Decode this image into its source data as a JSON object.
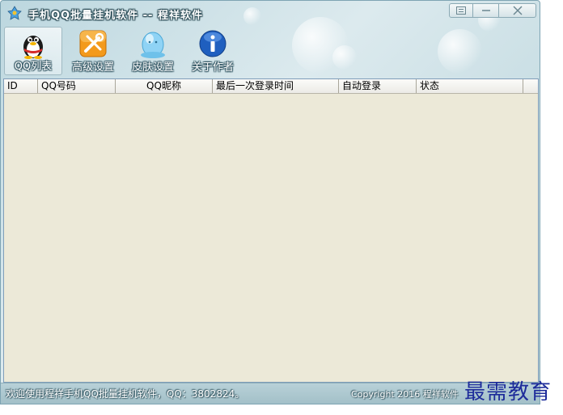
{
  "window": {
    "title": "手机QQ批量挂机软件 -- 程祥软件",
    "controls": [
      "menu-icon",
      "minimize-icon",
      "close-icon"
    ]
  },
  "toolbar": {
    "items": [
      {
        "label": "QQ列表",
        "icon": "qq-penguin-icon",
        "active": true
      },
      {
        "label": "高级设置",
        "icon": "tools-icon",
        "active": false
      },
      {
        "label": "皮肤设置",
        "icon": "skin-icon",
        "active": false
      },
      {
        "label": "关于作者",
        "icon": "info-icon",
        "active": false
      }
    ]
  },
  "table": {
    "columns": [
      "ID",
      "QQ号码",
      "QQ昵称",
      "最后一次登录时间",
      "自动登录",
      "状态"
    ],
    "rows": []
  },
  "status": {
    "left": "欢迎使用程祥手机QQ批量挂机软件，QQ：3802824。",
    "right": "Copyright 2016 程祥软件"
  },
  "watermark": "最需教育",
  "colors": {
    "grid_bg": "#ece9d8",
    "window_bg": "#c7dde3",
    "watermark": "#1d2b9a"
  }
}
